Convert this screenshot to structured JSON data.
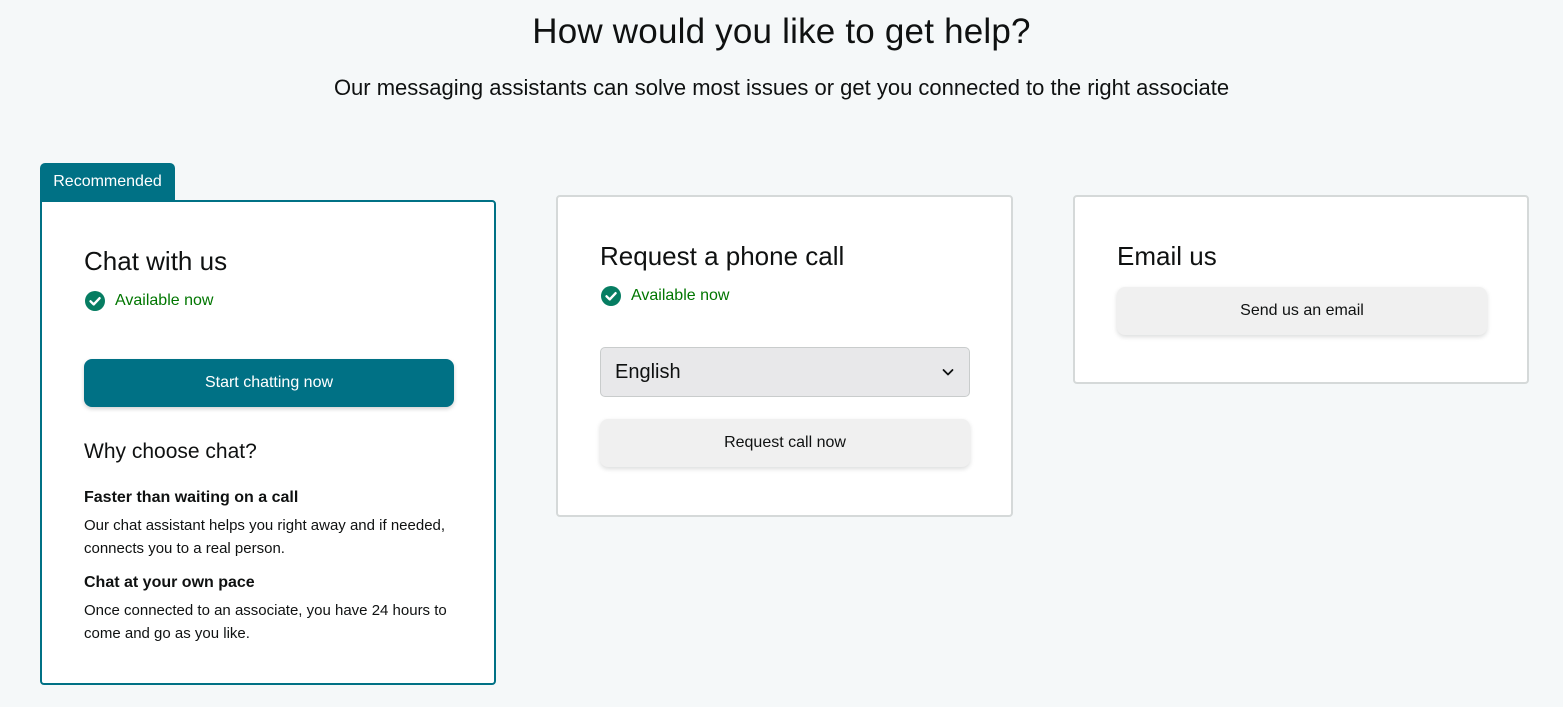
{
  "header": {
    "title": "How would you like to get help?",
    "subtitle": "Our messaging assistants can solve most issues or get you connected to the right associate"
  },
  "chat_card": {
    "badge": "Recommended",
    "title": "Chat with us",
    "availability": "Available now",
    "button_label": "Start chatting now",
    "why_title": "Why choose chat?",
    "reasons": [
      {
        "title": "Faster than waiting on a call",
        "text": "Our chat assistant helps you right away and if needed, connects you to a real person."
      },
      {
        "title": "Chat at your own pace",
        "text": "Once connected to an associate, you have 24 hours to come and go as you like."
      }
    ]
  },
  "phone_card": {
    "title": "Request a phone call",
    "availability": "Available now",
    "language_selected": "English",
    "button_label": "Request call now"
  },
  "email_card": {
    "title": "Email us",
    "button_label": "Send us an email"
  },
  "colors": {
    "accent": "#007185",
    "available": "#007600",
    "check_icon": "#067d62",
    "background": "#f5f8f9"
  }
}
